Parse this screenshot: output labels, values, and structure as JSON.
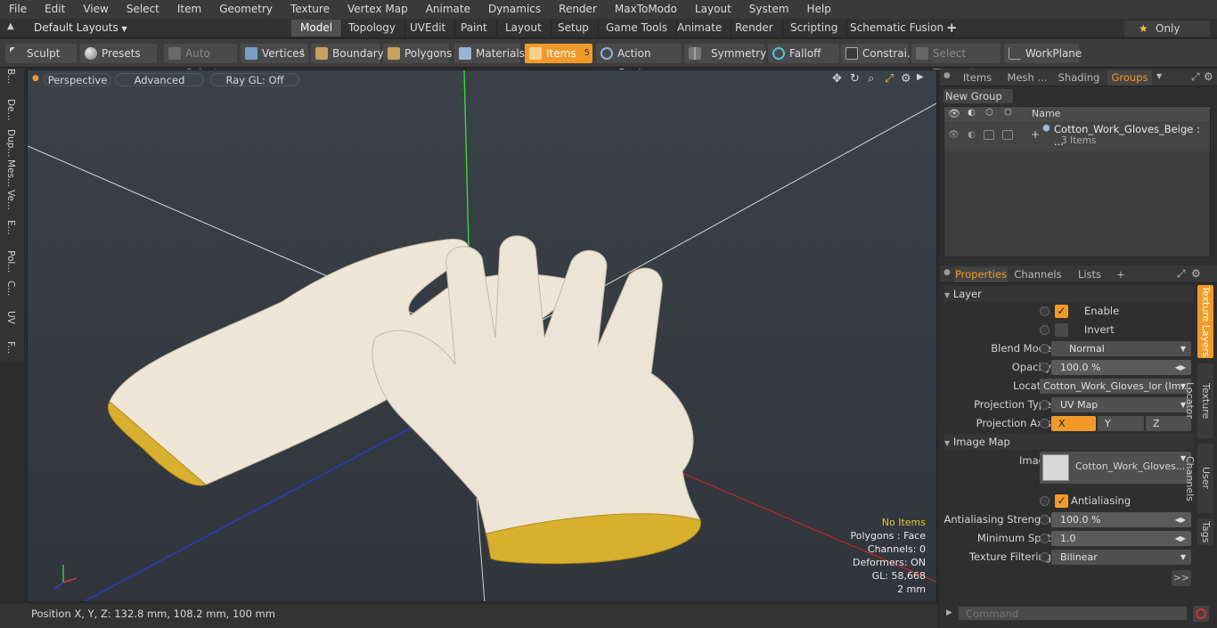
{
  "menu": [
    "File",
    "Edit",
    "View",
    "Select",
    "Item",
    "Geometry",
    "Texture",
    "Vertex Map",
    "Animate",
    "Dynamics",
    "Render",
    "MaxToModo",
    "Layout",
    "System",
    "Help"
  ],
  "layouts": {
    "selector": "Default Layouts",
    "tabs": [
      "Model",
      "Topology",
      "UVEdit",
      "Paint",
      "Layout",
      "Setup",
      "Game Tools",
      "Animate",
      "Render",
      "Scripting",
      "Schematic Fusion"
    ],
    "active": "Model",
    "add": "+",
    "only": "Only"
  },
  "toolbar": {
    "sculpt": "Sculpt",
    "presets": "Presets",
    "auto_select": "Auto Select",
    "vertices": "Vertices",
    "vertices_count": "1",
    "boundary": "Boundary",
    "polygons": "Polygons",
    "materials": "Materials",
    "items": "Items",
    "items_count": "5",
    "action_center": "Action Center",
    "symmetry": "Symmetry",
    "falloff": "Falloff",
    "constraints": "Constrai...",
    "select_through": "Select Through",
    "workplane": "WorkPlane"
  },
  "left_tabs": [
    "B...",
    "De...",
    "Dup...",
    "Mes...",
    "Ve...",
    "E...",
    "Pol...",
    "C...",
    "UV",
    "F..."
  ],
  "viewport": {
    "perspective": "Perspective",
    "advanced": "Advanced",
    "raygl": "Ray GL: Off",
    "stats": {
      "no_items": "No Items",
      "polygons": "Polygons : Face",
      "channels": "Channels: 0",
      "deformers": "Deformers: ON",
      "gl": "GL: 58,668",
      "scale": "2 mm"
    }
  },
  "status": {
    "position": "Position X, Y, Z:   132.8 mm, 108.2 mm, 100 mm"
  },
  "groups_panel": {
    "tabs": [
      "Items",
      "Mesh ...",
      "Shading",
      "Groups"
    ],
    "active": "Groups",
    "new_group": "New Group",
    "col_name": "Name",
    "group_name": "Cotton_Work_Gloves_Beige : ...",
    "group_count": "3 Items"
  },
  "properties_panel": {
    "tabs": [
      "Properties",
      "Channels",
      "Lists"
    ],
    "active": "Properties",
    "add": "+",
    "layer_section": "Layer",
    "enable": "Enable",
    "invert": "Invert",
    "blend_mode_label": "Blend Mode",
    "blend_mode": "Normal",
    "opacity_label": "Opacity",
    "opacity": "100.0 %",
    "locator_label": "Locator",
    "locator": "Cotton_Work_Gloves_lor (Im...",
    "projection_type_label": "Projection Type",
    "projection_type": "UV Map",
    "projection_axis_label": "Projection Axis",
    "axis_x": "X",
    "axis_y": "Y",
    "axis_z": "Z",
    "image_map_section": "Image Map",
    "image_label": "Image",
    "image": "Cotton_Work_Gloves...",
    "antialiasing": "Antialiasing",
    "aa_strength_label": "Antialiasing Strength",
    "aa_strength": "100.0 %",
    "min_spot_label": "Minimum Spot",
    "min_spot": "1.0",
    "tex_filter_label": "Texture Filtering",
    "tex_filter": "Bilinear",
    "more": ">>",
    "command_placeholder": "Command"
  },
  "side_tabs": [
    "Texture Layers",
    "Texture Locator",
    "User Channels",
    "Tags"
  ]
}
